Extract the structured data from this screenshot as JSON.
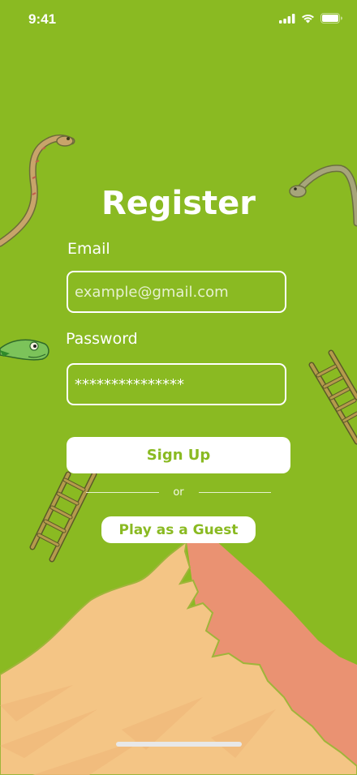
{
  "status_bar": {
    "time": "9:41",
    "icons": [
      "cellular-signal-icon",
      "wifi-icon",
      "battery-icon"
    ]
  },
  "form": {
    "title": "Register",
    "email_label": "Email",
    "email_placeholder": "example@gmail.com",
    "password_label": "Password",
    "password_value": "***************",
    "signup_label": "Sign Up",
    "divider_text": "or",
    "guest_label": "Play as a Guest"
  },
  "decorations": [
    "snake-illustration",
    "ladder-illustration",
    "mountain-illustration"
  ],
  "colors": {
    "background": "#8aba22",
    "text": "#ffffff",
    "button_text": "#8aba22",
    "mountain_light": "#f4c585",
    "mountain_dark": "#ea9272"
  }
}
